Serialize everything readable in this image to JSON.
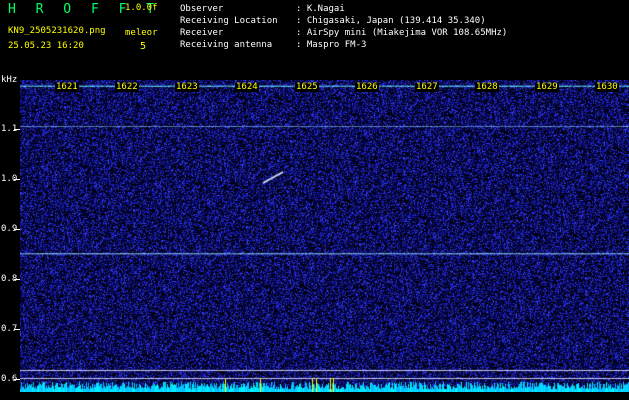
{
  "header": {
    "brand": "H R O F F T",
    "version": "1.0.0f",
    "filename": "KN9_2505231620.png",
    "datetime": "25.05.23 16:20",
    "meleor_label": "meleor",
    "meleor_count": "5",
    "fields": [
      {
        "label": "Observer",
        "value": ": K.Nagai"
      },
      {
        "label": "Receiving Location",
        "value": ": Chigasaki, Japan (139.414 35.340)"
      },
      {
        "label": "Receiver",
        "value": ": AirSpy mini (Miakejima VOR 108.65MHz)"
      },
      {
        "label": "Receiving antenna",
        "value": ": Maspro FM-3"
      }
    ]
  },
  "spectrogram": {
    "y_unit": "kHz",
    "y_ticks": [
      "1.1",
      "1.0",
      "0.9",
      "0.8",
      "0.7",
      "0.6"
    ],
    "minute_labels": [
      "1621",
      "1622",
      "1623",
      "1624",
      "1625",
      "1626",
      "1627",
      "1628",
      "1629",
      "1630"
    ],
    "colors": {
      "background": "#000000",
      "noise_low": "#0a0a60",
      "noise_high": "#3b3bff",
      "trace": "#ffffff",
      "label": "#ffff00"
    }
  }
}
